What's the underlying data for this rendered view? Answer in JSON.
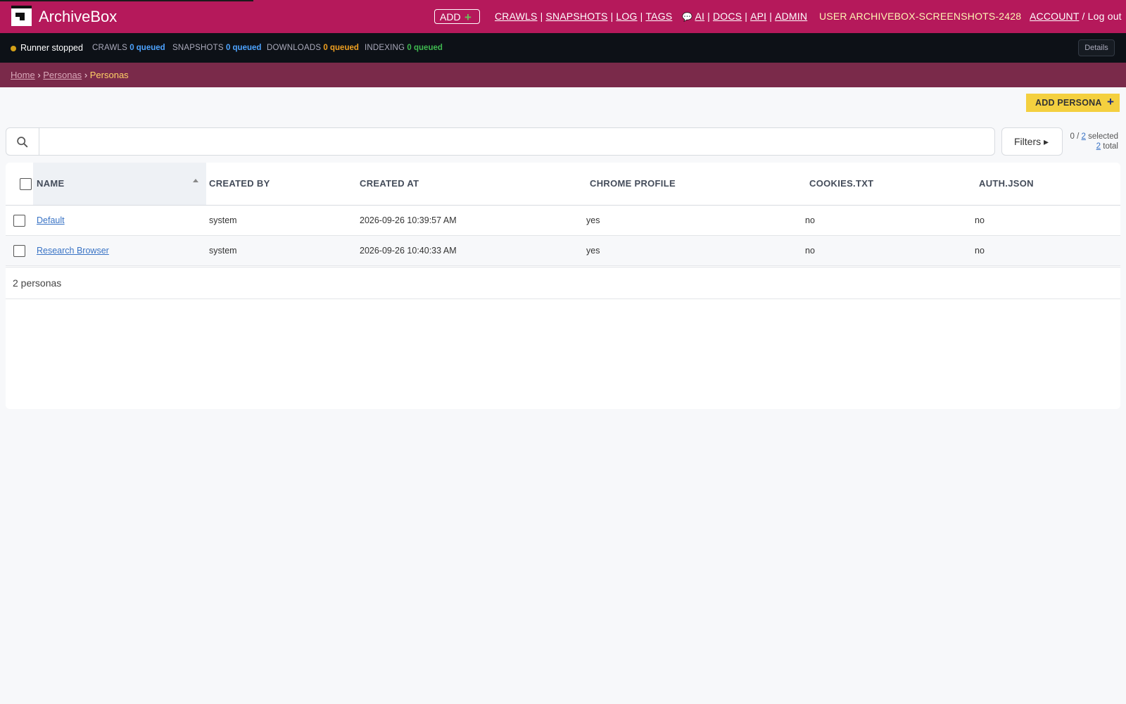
{
  "header": {
    "brand": "ArchiveBox",
    "add_label": "ADD",
    "nav_left": [
      "CRAWLS",
      "SNAPSHOTS",
      "LOG",
      "TAGS"
    ],
    "nav_mid": [
      "AI",
      "DOCS",
      "API",
      "ADMIN"
    ],
    "user_label": "USER ARCHIVEBOX-SCREENSHOTS-2428",
    "account_label": "ACCOUNT",
    "logout_label": "Log out"
  },
  "status": {
    "runner": "Runner stopped",
    "crawls_label": "CRAWLS",
    "crawls_value": "0 queued",
    "snapshots_label": "SNAPSHOTS",
    "snapshots_value": "0 queued",
    "downloads_label": "DOWNLOADS",
    "downloads_value": "0 queued",
    "indexing_label": "INDEXING",
    "indexing_value": "0 queued",
    "details": "Details"
  },
  "breadcrumb": {
    "home": "Home",
    "parent": "Personas",
    "current": "Personas"
  },
  "toolbar": {
    "add_persona": "ADD PERSONA",
    "search_placeholder": "",
    "filters": "Filters ▸",
    "selected_count": "0",
    "selected_total": "2",
    "selected_suffix": "selected",
    "total_count": "2",
    "total_suffix": "total"
  },
  "table": {
    "columns": [
      "NAME",
      "CREATED BY",
      "CREATED AT",
      "CHROME PROFILE",
      "COOKIES.TXT",
      "AUTH.JSON"
    ],
    "rows": [
      {
        "name": "Default",
        "created_by": "system",
        "created_at": "2026-09-26 10:39:57 AM",
        "chrome_profile": "yes",
        "cookies": "no",
        "auth": "no"
      },
      {
        "name": "Research Browser",
        "created_by": "system",
        "created_at": "2026-09-26 10:40:33 AM",
        "chrome_profile": "yes",
        "cookies": "no",
        "auth": "no"
      }
    ],
    "footer": "2 personas"
  },
  "colors": {
    "header_bg": "#b5195b",
    "statusbar_bg": "#0d1117",
    "breadcrumb_bg": "#7a2a4a",
    "add_persona_bg": "#f4d03f"
  }
}
